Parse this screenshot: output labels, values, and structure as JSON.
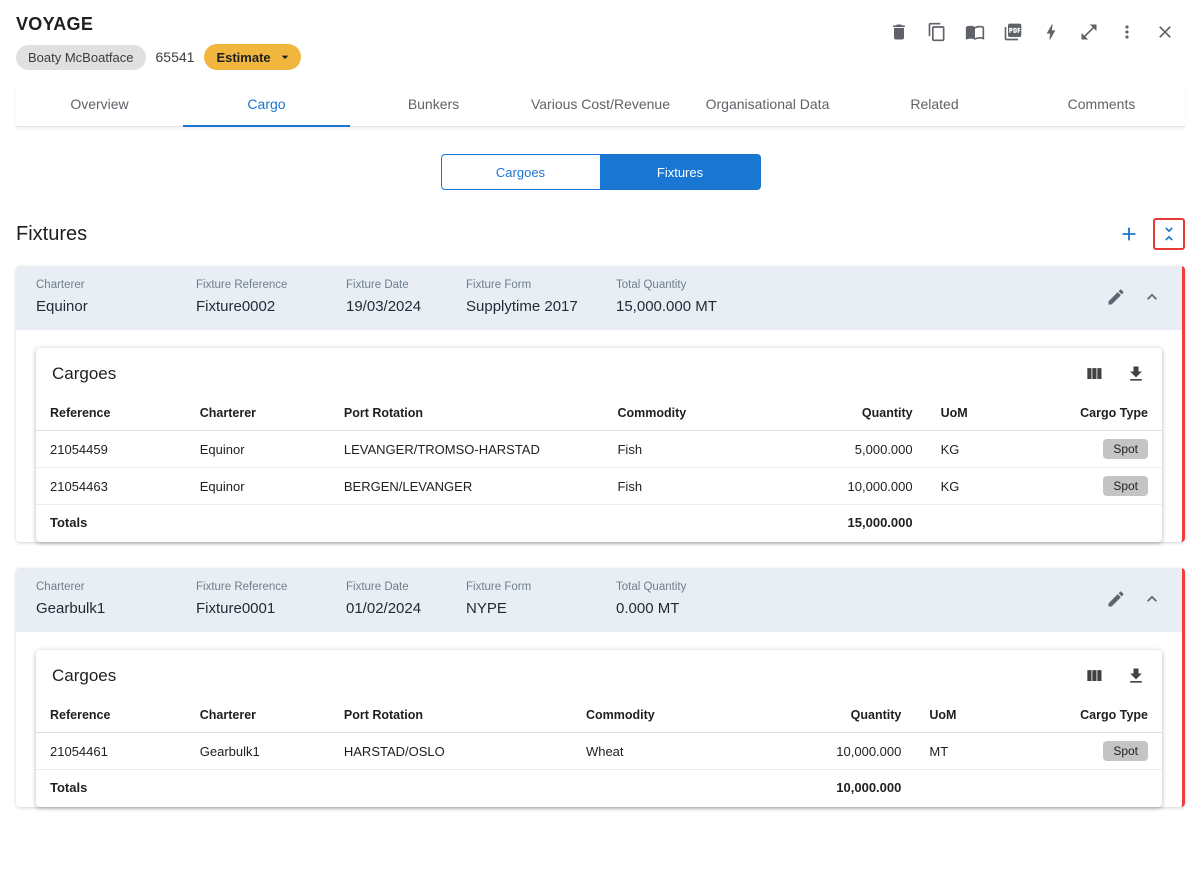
{
  "header": {
    "title": "VOYAGE",
    "vessel": "Boaty McBoatface",
    "voyage_number": "65541",
    "status": "Estimate"
  },
  "tabs": [
    {
      "label": "Overview"
    },
    {
      "label": "Cargo"
    },
    {
      "label": "Bunkers"
    },
    {
      "label": "Various Cost/Revenue"
    },
    {
      "label": "Organisational Data"
    },
    {
      "label": "Related"
    },
    {
      "label": "Comments"
    }
  ],
  "toggle": {
    "cargoes": "Cargoes",
    "fixtures": "Fixtures"
  },
  "section_title": "Fixtures",
  "fixtures": [
    {
      "fields": [
        {
          "label": "Charterer",
          "value": "Equinor"
        },
        {
          "label": "Fixture Reference",
          "value": "Fixture0002"
        },
        {
          "label": "Fixture Date",
          "value": "19/03/2024"
        },
        {
          "label": "Fixture Form",
          "value": "Supplytime 2017"
        },
        {
          "label": "Total Quantity",
          "value": "15,000.000 MT"
        }
      ],
      "cargoes": {
        "title": "Cargoes",
        "columns": [
          "Reference",
          "Charterer",
          "Port Rotation",
          "Commodity",
          "Quantity",
          "UoM",
          "Cargo Type"
        ],
        "rows": [
          {
            "reference": "21054459",
            "charterer": "Equinor",
            "port_rotation": "LEVANGER/TROMSO-HARSTAD",
            "commodity": "Fish",
            "quantity": "5,000.000",
            "uom": "KG",
            "cargo_type": "Spot"
          },
          {
            "reference": "21054463",
            "charterer": "Equinor",
            "port_rotation": "BERGEN/LEVANGER",
            "commodity": "Fish",
            "quantity": "10,000.000",
            "uom": "KG",
            "cargo_type": "Spot"
          }
        ],
        "totals_label": "Totals",
        "total_quantity": "15,000.000"
      }
    },
    {
      "fields": [
        {
          "label": "Charterer",
          "value": "Gearbulk1"
        },
        {
          "label": "Fixture Reference",
          "value": "Fixture0001"
        },
        {
          "label": "Fixture Date",
          "value": "01/02/2024"
        },
        {
          "label": "Fixture Form",
          "value": "NYPE"
        },
        {
          "label": "Total Quantity",
          "value": "0.000 MT"
        }
      ],
      "cargoes": {
        "title": "Cargoes",
        "columns": [
          "Reference",
          "Charterer",
          "Port Rotation",
          "Commodity",
          "Quantity",
          "UoM",
          "Cargo Type"
        ],
        "rows": [
          {
            "reference": "21054461",
            "charterer": "Gearbulk1",
            "port_rotation": "HARSTAD/OSLO",
            "commodity": "Wheat",
            "quantity": "10,000.000",
            "uom": "MT",
            "cargo_type": "Spot"
          }
        ],
        "totals_label": "Totals",
        "total_quantity": "10,000.000"
      }
    }
  ],
  "colors": {
    "accent": "#1976d2",
    "header_bg": "#e8eef4",
    "error": "#ef3b3b",
    "estimate_chip": "#f0b63e"
  }
}
